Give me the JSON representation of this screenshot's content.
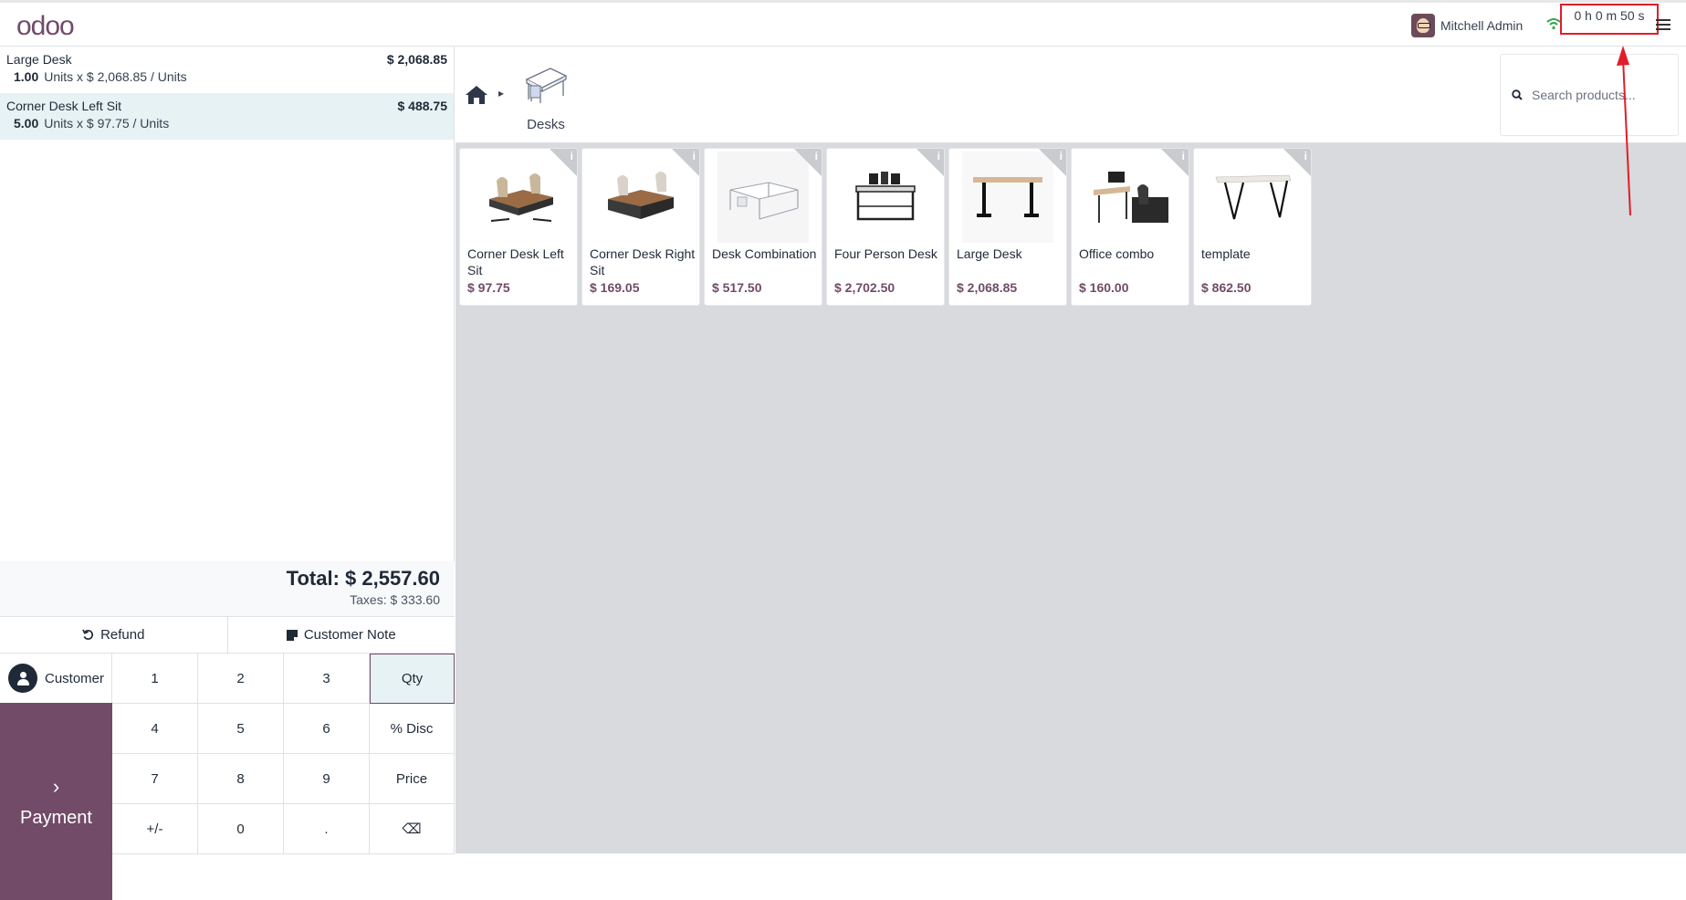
{
  "header": {
    "logo": "odoo",
    "user_name": "Mitchell Admin",
    "timer": "0 h 0 m 50 s"
  },
  "order": {
    "lines": [
      {
        "name": "Large Desk",
        "price": "$ 2,068.85",
        "qty": "1.00",
        "detail": "Units x $ 2,068.85 / Units"
      },
      {
        "name": "Corner Desk Left Sit",
        "price": "$ 488.75",
        "qty": "5.00",
        "detail": "Units x $ 97.75 / Units"
      }
    ],
    "total": "Total: $ 2,557.60",
    "taxes": "Taxes: $ 333.60"
  },
  "actions": {
    "refund": "Refund",
    "customer_note": "Customer Note"
  },
  "pad": {
    "customer": "Customer",
    "payment": "Payment",
    "keys": [
      "1",
      "2",
      "3",
      "Qty",
      "4",
      "5",
      "6",
      "% Disc",
      "7",
      "8",
      "9",
      "Price",
      "+/-",
      "0",
      ".",
      "⌫"
    ]
  },
  "category": {
    "label": "Desks"
  },
  "search": {
    "placeholder": "Search products..."
  },
  "products": [
    {
      "name": "Corner Desk Left Sit",
      "price": "$ 97.75"
    },
    {
      "name": "Corner Desk Right Sit",
      "price": "$ 169.05"
    },
    {
      "name": "Desk Combination",
      "price": "$ 517.50"
    },
    {
      "name": "Four Person Desk",
      "price": "$ 2,702.50"
    },
    {
      "name": "Large Desk",
      "price": "$ 2,068.85"
    },
    {
      "name": "Office combo",
      "price": "$ 160.00"
    },
    {
      "name": "template",
      "price": "$ 862.50"
    }
  ],
  "colors": {
    "brand": "#714b67",
    "selected_line": "#e6f2f3",
    "annotation": "#e11d2a"
  }
}
